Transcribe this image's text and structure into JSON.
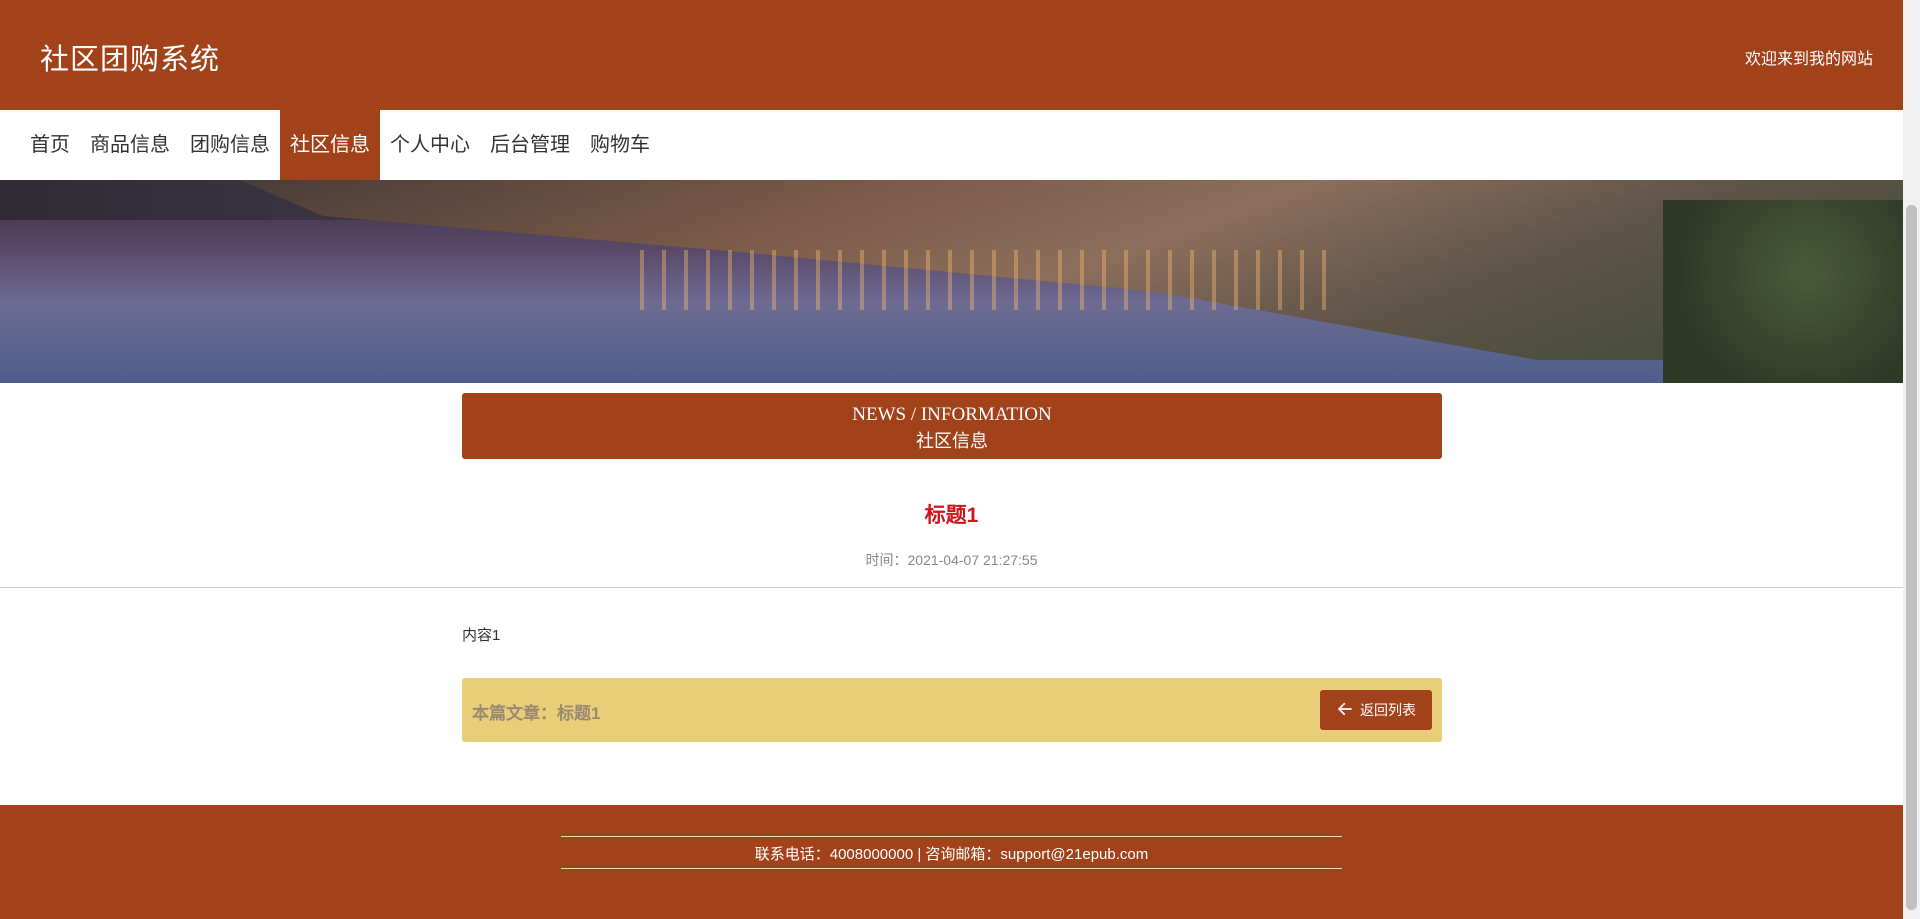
{
  "header": {
    "site_title": "社区团购系统",
    "welcome": "欢迎来到我的网站"
  },
  "nav": {
    "items": [
      {
        "label": "首页"
      },
      {
        "label": "商品信息"
      },
      {
        "label": "团购信息"
      },
      {
        "label": "社区信息",
        "active": true
      },
      {
        "label": "个人中心"
      },
      {
        "label": "后台管理"
      },
      {
        "label": "购物车"
      }
    ]
  },
  "banner": {
    "slides": 3,
    "active_slide": 1
  },
  "section": {
    "title_en": "NEWS / INFORMATION",
    "title_cn": "社区信息"
  },
  "article": {
    "title": "标题1",
    "time": "时间：2021-04-07 21:27:55",
    "content": "内容1",
    "this_article": "本篇文章：标题1",
    "back_label": "返回列表"
  },
  "footer": {
    "contact": "联系电话：4008000000 | 咨询邮箱：support@21epub.com"
  },
  "colors": {
    "primary": "#a1421b",
    "bar": "#e8ce78",
    "title_red": "#d0151a"
  }
}
